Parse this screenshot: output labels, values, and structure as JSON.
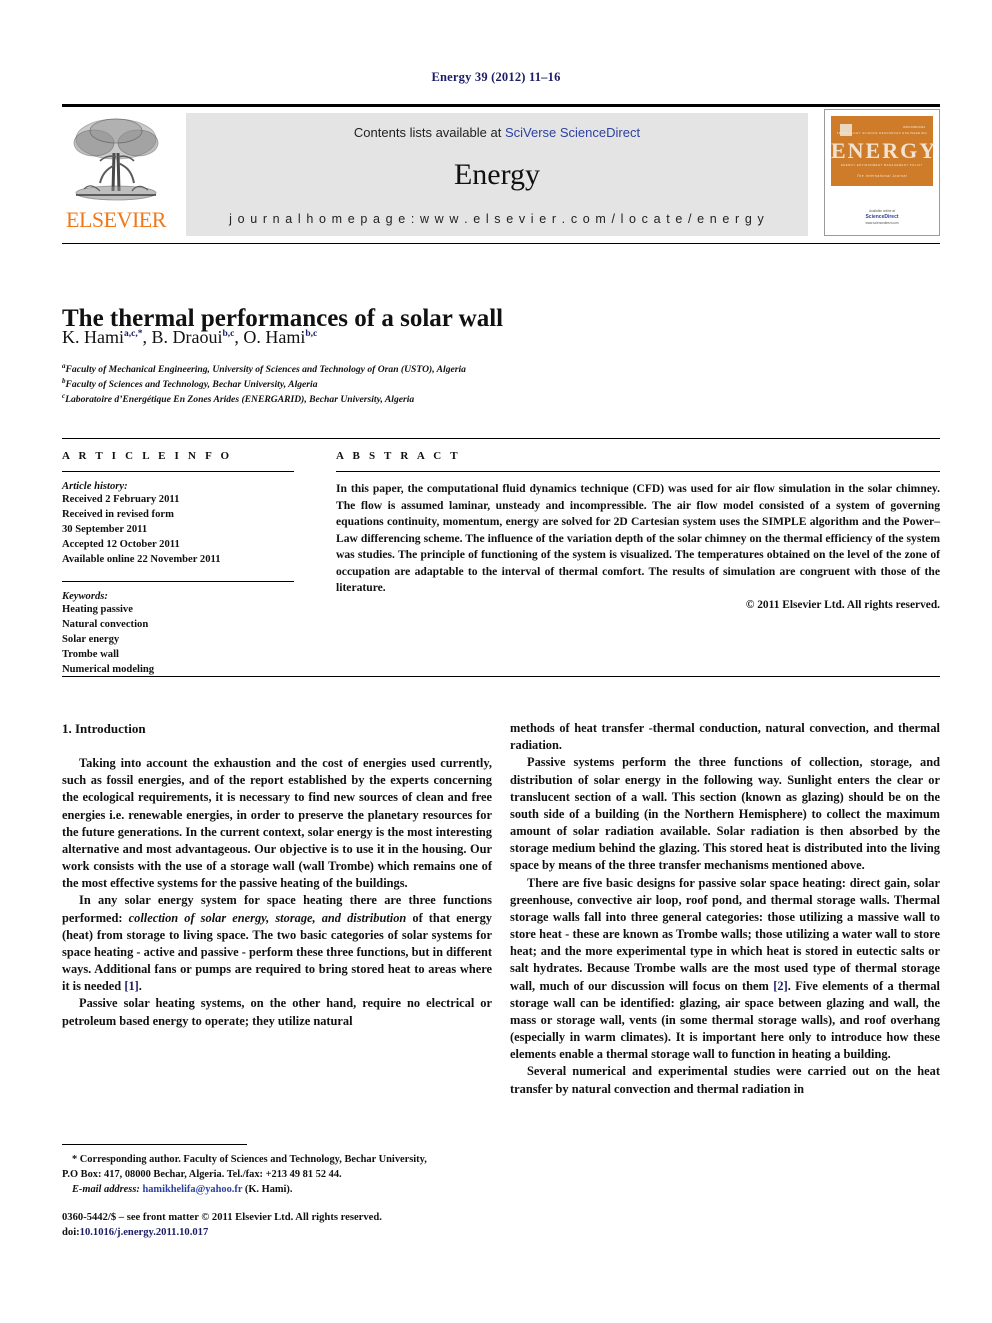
{
  "running_head": "Energy 39 (2012) 11–16",
  "masthead": {
    "contents_prefix": "Contents lists available at ",
    "sciencedirect_link": "SciVerse ScienceDirect",
    "journal_title": "Energy",
    "homepage": "j o u r n a l   h o m e p a g e :   w w w . e l s e v i e r . c o m / l o c a t e / e n e r g y",
    "publisher_wordmark": "ELSEVIER",
    "cover": {
      "title": "ENERGY",
      "top_row": "TECHNOLOGY          SCIENCE          RESOURCES          ENGINEERING",
      "mid_row": "ENERGY        ENVIRONMENT        MANAGEMENT        POLICY",
      "tagline": "The International Journal",
      "issn": "ISSN 0360-5442",
      "foot_available": "Available online at",
      "foot_sd": "ScienceDirect",
      "foot_url": "www.sciencedirect.com"
    }
  },
  "article": {
    "title": "The thermal performances of a solar wall",
    "authors": [
      {
        "name": "K. Hami",
        "sup": "a,c,*"
      },
      {
        "name": "B. Draoui",
        "sup": "b,c"
      },
      {
        "name": "O. Hami",
        "sup": "b,c"
      }
    ],
    "affiliations": [
      {
        "marker": "a",
        "text": "Faculty of Mechanical Engineering, University of Sciences and Technology of Oran (USTO), Algeria"
      },
      {
        "marker": "b",
        "text": "Faculty of Sciences and Technology, Bechar University, Algeria"
      },
      {
        "marker": "c",
        "text": "Laboratoire d’Energétique En Zones Arides (ENERGARID), Bechar University, Algeria"
      }
    ]
  },
  "article_info": {
    "heading": "A R T I C L E   I N F O",
    "history_label": "Article history:",
    "history": [
      "Received 2 February 2011",
      "Received in revised form",
      "30 September 2011",
      "Accepted 12 October 2011",
      "Available online 22 November 2011"
    ],
    "keywords_label": "Keywords:",
    "keywords": [
      "Heating passive",
      "Natural convection",
      "Solar energy",
      "Trombe wall",
      "Numerical modeling"
    ]
  },
  "abstract": {
    "heading": "A B S T R A C T",
    "text": "In this paper, the computational fluid dynamics technique (CFD) was used for air flow simulation in the solar chimney. The flow is assumed laminar, unsteady and incompressible. The air flow model consisted of a system of governing equations continuity, momentum, energy are solved for 2D Cartesian system uses the SIMPLE algorithm and the Power–Law differencing scheme. The influence of the variation depth of the solar chimney on the thermal efficiency of the system was studies. The principle of functioning of the system is visualized. The temperatures obtained on the level of the zone of occupation are adaptable to the interval of thermal comfort. The results of simulation are congruent with those of the literature.",
    "copyright": "© 2011 Elsevier Ltd. All rights reserved."
  },
  "body": {
    "section_heading": "1.  Introduction",
    "left": {
      "p1": "Taking into account the exhaustion and the cost of energies used currently, such as fossil energies, and of the report established by the experts concerning the ecological requirements, it is necessary to find new sources of clean and free energies i.e. renewable energies, in order to preserve the planetary resources for the future generations. In the current context, solar energy is the most interesting alternative and most advantageous. Our objective is to use it in the housing. Our work consists with the use of a storage wall (wall Trombe) which remains one of the most effective systems for the passive heating of the buildings.",
      "p2_a": "In any solar energy system for space heating there are three functions performed: ",
      "p2_ital": "collection of solar energy, storage, and distribution",
      "p2_b": " of that energy (heat) from storage to living space. The two basic categories of solar systems for space heating - active and passive - perform these three functions, but in different ways. Additional fans or pumps are required to bring stored heat to areas where it is needed ",
      "p2_ref": "[1]",
      "p2_c": ".",
      "p3": "Passive solar heating systems, on the other hand, require no electrical or petroleum based energy to operate; they utilize natural"
    },
    "right": {
      "p1": "methods of heat transfer -thermal conduction, natural convection, and thermal radiation.",
      "p2": "Passive systems perform the three functions of collection, storage, and distribution of solar energy in the following way. Sunlight enters the clear or translucent section of a wall. This section (known as glazing) should be on the south side of a building (in the Northern Hemisphere) to collect the maximum amount of solar radiation available. Solar radiation is then absorbed by the storage medium behind the glazing. This stored heat is distributed into the living space by means of the three transfer mechanisms mentioned above.",
      "p3_a": "There are five basic designs for passive solar space heating: direct gain, solar greenhouse, convective air loop, roof pond, and thermal storage walls. Thermal storage walls fall into three general categories: those utilizing a massive wall to store heat - these are known as Trombe walls; those utilizing a water wall to store heat; and the more experimental type in which heat is stored in eutectic salts or salt hydrates. Because Trombe walls are the most used type of thermal storage wall, much of our discussion will focus on them ",
      "p3_ref": "[2]",
      "p3_b": ". Five elements of a thermal storage wall can be identified: glazing, air space between glazing and wall, the mass or storage wall, vents (in some thermal storage walls), and roof overhang (especially in warm climates). It is important here only to introduce how these elements enable a thermal storage wall to function in heating a building.",
      "p4": "Several numerical and experimental studies were carried out on the heat transfer by natural convection and thermal radiation in"
    }
  },
  "footnote": {
    "line1": "* Corresponding author. Faculty of Sciences and Technology, Bechar University,",
    "line2": "P.O Box: 417, 08000 Bechar, Algeria. Tel./fax: +213 49 81 52 44.",
    "email_label": "E-mail address:",
    "email": "hamikhelifa@yahoo.fr",
    "email_suffix": " (K. Hami)."
  },
  "colophon": {
    "front_matter": "0360-5442/$ – see front matter © 2011 Elsevier Ltd. All rights reserved.",
    "doi_label": "doi:",
    "doi": "10.1016/j.energy.2011.10.017"
  }
}
